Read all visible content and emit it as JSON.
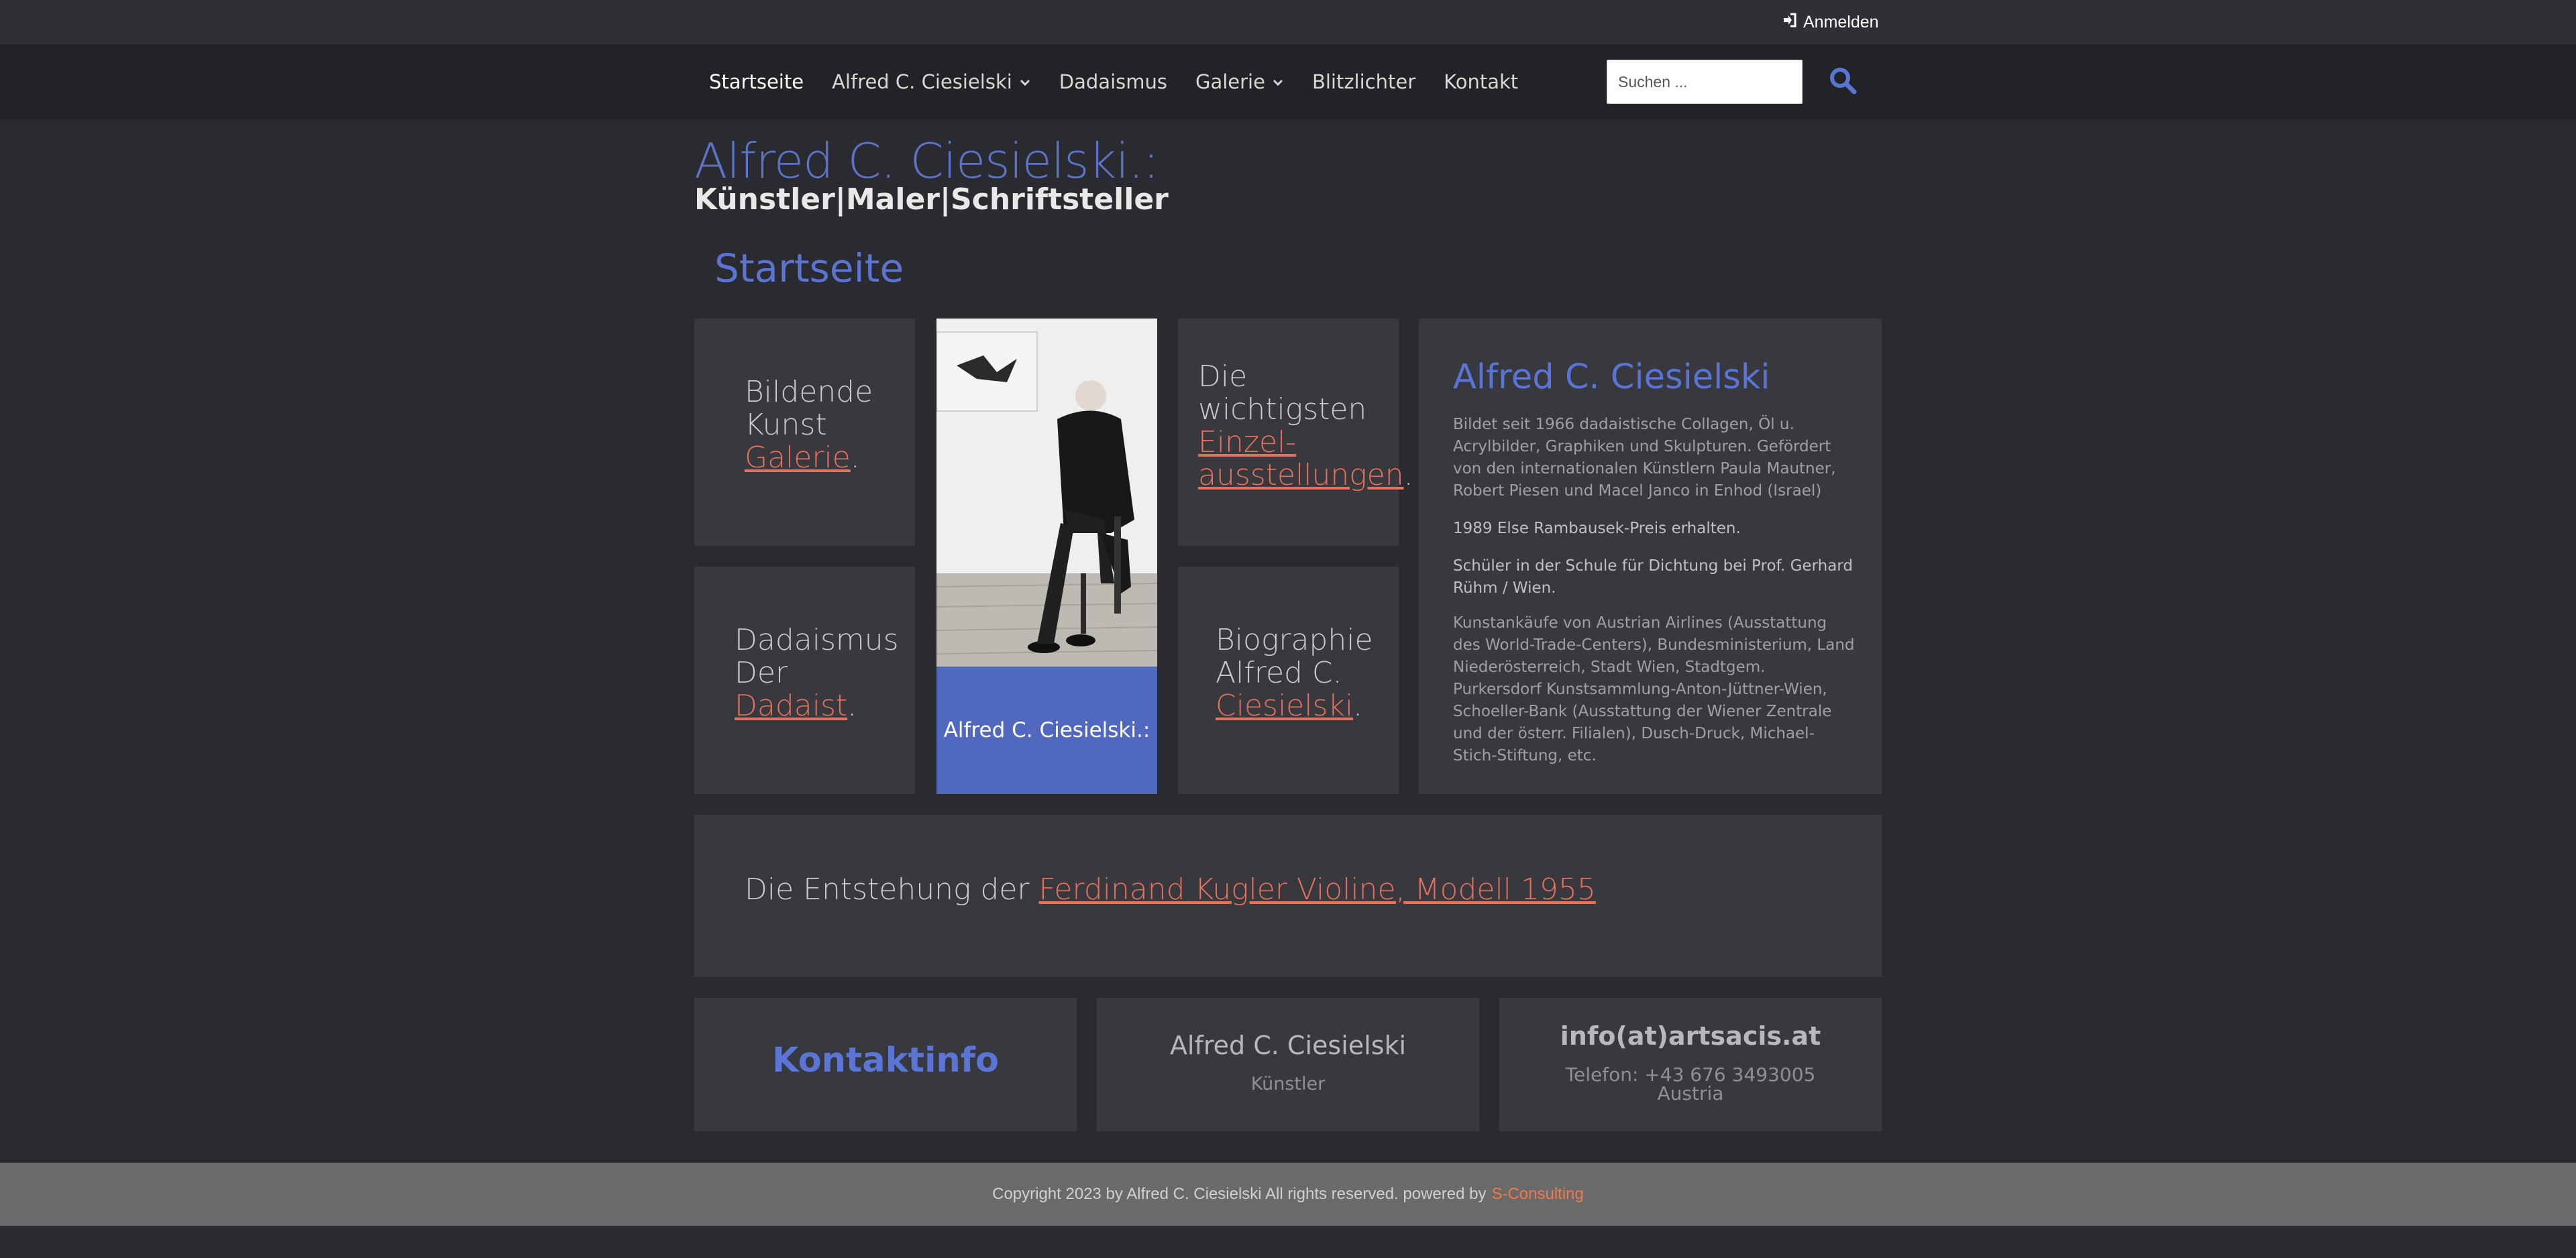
{
  "topbar": {
    "login_label": "Anmelden"
  },
  "nav": {
    "items": [
      {
        "label": "Startseite"
      },
      {
        "label": "Alfred C. Ciesielski"
      },
      {
        "label": "Dadaismus"
      },
      {
        "label": "Galerie"
      },
      {
        "label": "Blitzlichter"
      },
      {
        "label": "Kontakt"
      }
    ],
    "search_placeholder": "Suchen ..."
  },
  "header": {
    "title": "Alfred C. Ciesielski.:",
    "subtitle": "Künstler|Maler|Schriftsteller"
  },
  "page": {
    "heading": "Startseite"
  },
  "tiles": {
    "art": {
      "line1": "Bildende",
      "line2": "Kunst",
      "link": "Galerie"
    },
    "exhibitions": {
      "line1": "Die",
      "line2": "wichtigsten",
      "link1": "Einzel-",
      "link2": "ausstellungen"
    },
    "dada": {
      "line1": "Dadaismus",
      "line2": "Der",
      "link": "Dadaist"
    },
    "biography": {
      "line1": "Biographie",
      "line2": "Alfred C.",
      "link": "Ciesielski"
    },
    "photo_caption": "Alfred C. Ciesielski.:",
    "dot": "."
  },
  "bio": {
    "title": "Alfred C. Ciesielski",
    "para1": "Bildet seit 1966 dadaistische Collagen, Öl u. Acrylbilder, Graphiken und Skulpturen. Gefördert von den internationalen Künstlern Paula Mautner, Robert Piesen und Macel Janco in Enhod (Israel)",
    "para2": "1989 Else Rambausek-Preis erhalten.",
    "para3": "Schüler in der Schule für Dichtung bei Prof. Gerhard Rühm / Wien.",
    "para4": "Kunstankäufe von Austrian Airlines (Ausstattung des World-Trade-Centers), Bundesministerium, Land Niederösterreich, Stadt Wien, Stadtgem. Purkersdorf Kunstsammlung-Anton-Jüttner-Wien, Schoeller-Bank (Ausstattung der Wiener Zentrale und der österr. Filialen), Dusch-Druck, Michael-Stich-Stiftung, etc."
  },
  "violin": {
    "prefix": "Die Entstehung der",
    "link": "Ferdinand Kugler Violine, Modell 1955"
  },
  "footer_tiles": {
    "contact_heading": "Kontaktinfo",
    "name": "Alfred C. Ciesielski",
    "role": "Künstler",
    "email": "info(at)artsacis.at",
    "phone": "Telefon: +43 676 3493005",
    "country": "Austria"
  },
  "copyright": {
    "text": "Copyright 2023 by Alfred C. Ciesielski All rights reserved. powered by",
    "link": "S-Consulting"
  },
  "colors": {
    "accent_blue": "#5a75d6",
    "link_orange": "#e8705a",
    "background": "#2a2b30",
    "tile": "#38393f"
  }
}
